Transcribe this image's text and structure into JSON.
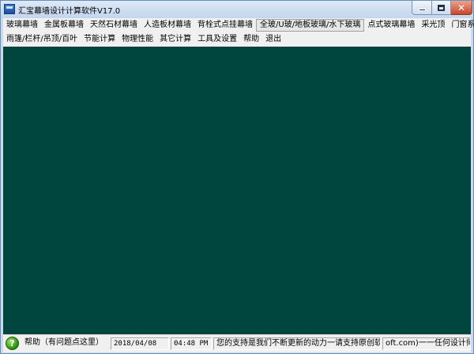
{
  "window": {
    "title": "汇宝幕墙设计计算软件V17.0"
  },
  "menu": {
    "row1": [
      "玻璃幕墙",
      "金属板幕墙",
      "天然石材幕墙",
      "人造板材幕墙",
      "背栓式点挂幕墙",
      "全玻/U玻/地板玻璃/水下玻璃",
      "点式玻璃幕墙",
      "采光顶",
      "门窗系统"
    ],
    "row2": [
      "雨篷/栏杆/吊顶/百叶",
      "节能计算",
      "物理性能",
      "其它计算",
      "工具及设置",
      "帮助",
      "退出"
    ],
    "active_item": "全玻/U玻/地板玻璃/水下玻璃"
  },
  "client": {
    "background": "#00463f"
  },
  "statusbar": {
    "help_label": "帮助（有问题点这里）",
    "date": "2018/04/08",
    "time": "04:48 PM",
    "message": "您的支持是我们不断更新的动力一请支持原创软件",
    "tail": "oft.com)一一任何设计师"
  },
  "icons": {
    "app": "app-icon",
    "help": "help-icon"
  }
}
